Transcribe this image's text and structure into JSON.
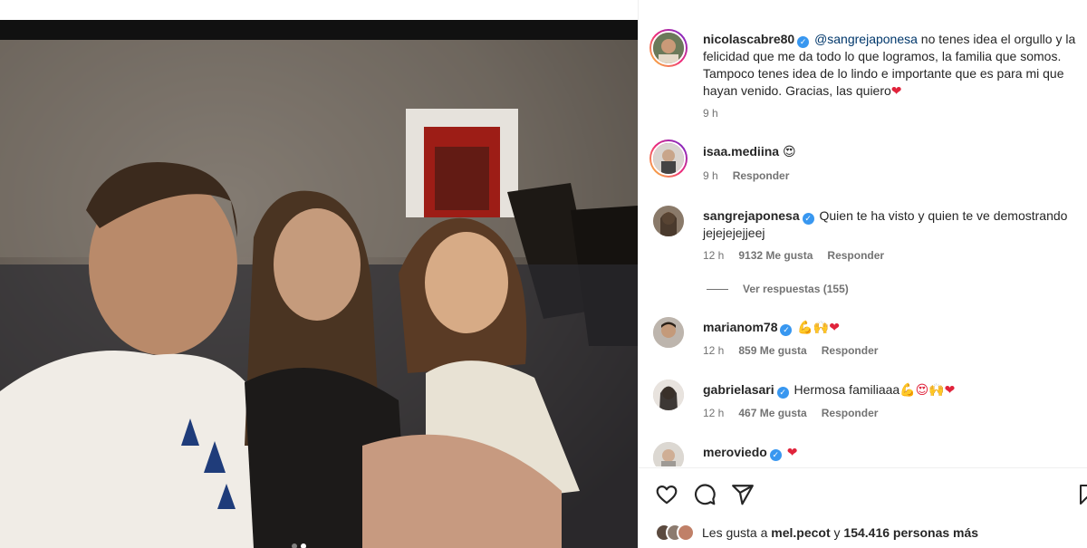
{
  "post": {
    "carousel": {
      "count": 2,
      "active_index": 1
    }
  },
  "caption": {
    "username": "nicolascabre80",
    "verified": true,
    "mention": "@sangrejaponesa",
    "text": " no tenes idea el orgullo y la felicidad que me da todo lo que logramos, la familia que somos. Tampoco tenes idea de lo lindo e importante que es para mi que hayan venido. Gracias, las quiero",
    "emoji": "❤",
    "time": "9 h"
  },
  "comments": [
    {
      "username": "isaa.mediina",
      "verified": false,
      "text": "",
      "emoji": "😍",
      "time": "9 h",
      "likes": "",
      "reply_label": "Responder"
    },
    {
      "username": "sangrejaponesa",
      "verified": true,
      "text": "Quien te ha visto y quien te ve demostrando jejejejejjeej",
      "emoji": "",
      "time": "12 h",
      "likes": "9132 Me gusta",
      "reply_label": "Responder",
      "view_replies": "Ver respuestas (155)"
    },
    {
      "username": "marianom78",
      "verified": true,
      "text": "",
      "emoji": "💪🙌❤",
      "time": "12 h",
      "likes": "859 Me gusta",
      "reply_label": "Responder"
    },
    {
      "username": "gabrielasari",
      "verified": true,
      "text": "Hermosa familiaaa",
      "emoji": "💪😍🙌❤",
      "time": "12 h",
      "likes": "467 Me gusta",
      "reply_label": "Responder"
    },
    {
      "username": "meroviedo",
      "verified": true,
      "text": "",
      "emoji": "❤",
      "time": "",
      "likes": "",
      "reply_label": ""
    }
  ],
  "actions": {
    "icons": [
      "heart-icon",
      "comment-icon",
      "share-icon",
      "bookmark-icon"
    ]
  },
  "likes_summary": {
    "prefix": "Les gusta a ",
    "user": "mel.pecot",
    "middle": " y ",
    "count": "154.416 personas más"
  },
  "colors": {
    "verified": "#3897f0",
    "mention": "#00376b",
    "heart": "#e0233b",
    "muted": "#737373"
  }
}
